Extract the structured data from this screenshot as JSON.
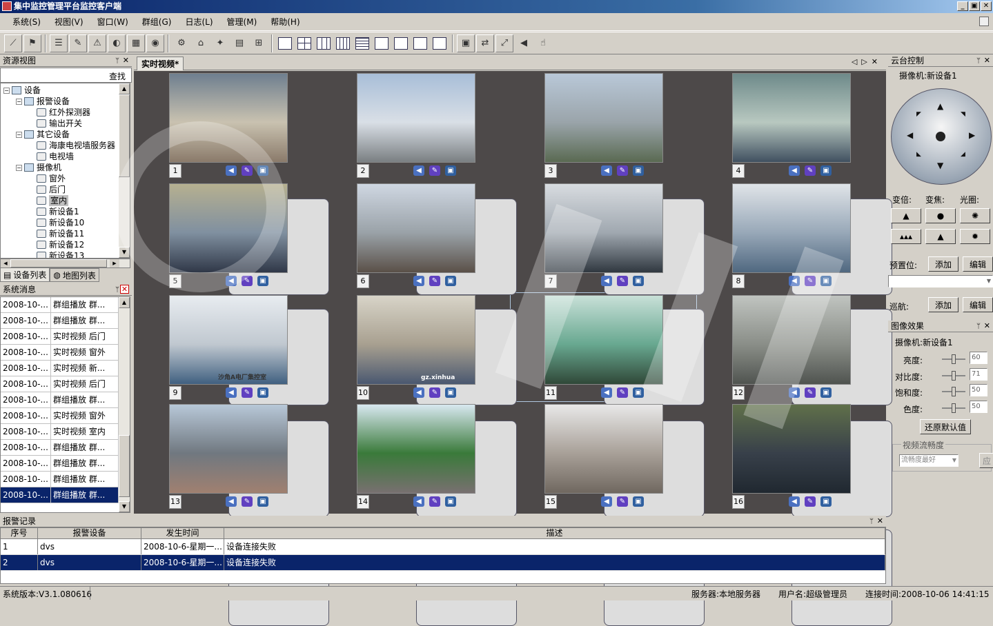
{
  "window": {
    "title": "集中监控管理平台监控客户端",
    "min": "_",
    "max": "▣",
    "close": "✕"
  },
  "menu": [
    "系统(S)",
    "视图(V)",
    "窗口(W)",
    "群组(G)",
    "日志(L)",
    "管理(M)",
    "帮助(H)"
  ],
  "resource": {
    "title": "资源视图",
    "search_label": "查找",
    "tree": [
      {
        "label": "设备",
        "level": 0,
        "exp": "−"
      },
      {
        "label": "报警设备",
        "level": 1,
        "exp": "−"
      },
      {
        "label": "红外探测器",
        "level": 2
      },
      {
        "label": "输出开关",
        "level": 2
      },
      {
        "label": "其它设备",
        "level": 1,
        "exp": "−"
      },
      {
        "label": "海康电视墙服务器",
        "level": 2
      },
      {
        "label": "电视墙",
        "level": 2
      },
      {
        "label": "摄像机",
        "level": 1,
        "exp": "−"
      },
      {
        "label": "窗外",
        "level": 2
      },
      {
        "label": "后门",
        "level": 2
      },
      {
        "label": "室内",
        "level": 2,
        "selected": true
      },
      {
        "label": "新设备1",
        "level": 2
      },
      {
        "label": "新设备10",
        "level": 2
      },
      {
        "label": "新设备11",
        "level": 2
      },
      {
        "label": "新设备12",
        "level": 2
      },
      {
        "label": "新设备13",
        "level": 2
      }
    ],
    "tabs": [
      "设备列表",
      "地图列表"
    ]
  },
  "messages": {
    "title": "系统消息",
    "rows": [
      [
        "2008-10-...",
        "群组播放  群..."
      ],
      [
        "2008-10-...",
        "群组播放  群..."
      ],
      [
        "2008-10-...",
        "实时视频  后门"
      ],
      [
        "2008-10-...",
        "实时视频  窗外"
      ],
      [
        "2008-10-...",
        "实时视频  新..."
      ],
      [
        "2008-10-...",
        "实时视频  后门"
      ],
      [
        "2008-10-...",
        "群组播放  群..."
      ],
      [
        "2008-10-...",
        "实时视频  窗外"
      ],
      [
        "2008-10-...",
        "实时视频  室内"
      ],
      [
        "2008-10-...",
        "群组播放  群..."
      ],
      [
        "2008-10-...",
        "群组播放  群..."
      ],
      [
        "2008-10-...",
        "群组播放  群..."
      ],
      [
        "2008-10-...",
        "群组播放  群..."
      ]
    ]
  },
  "video": {
    "tab": "实时视频*",
    "cells": [
      "1",
      "2",
      "3",
      "4",
      "5",
      "6",
      "7",
      "8",
      "9",
      "10",
      "11",
      "12",
      "13",
      "14",
      "15",
      "16"
    ],
    "captions": {
      "c9": "沙角A电厂集控室",
      "c10": "gz.xinhua"
    }
  },
  "ptz": {
    "title": "云台控制",
    "camera": "摄像机:新设备1",
    "zoom": "变倍:",
    "focus": "变焦:",
    "iris": "光圈:",
    "preset": "预置位:",
    "cruise": "巡航:",
    "add": "添加",
    "edit": "编辑"
  },
  "image": {
    "title": "图像效果",
    "camera": "摄像机:新设备1",
    "brightness": "亮度:",
    "brightness_v": "60",
    "contrast": "对比度:",
    "contrast_v": "71",
    "saturation": "饱和度:",
    "saturation_v": "50",
    "hue": "色度:",
    "hue_v": "50",
    "reset": "还原默认值",
    "smooth_group": "视频流畅度",
    "smooth_value": "流畅度最好",
    "apply": "应"
  },
  "alarms": {
    "title": "报警记录",
    "headers": [
      "序号",
      "报警设备",
      "发生时间",
      "描述"
    ],
    "rows": [
      [
        "1",
        "dvs",
        "2008-10-6-星期一...",
        "设备连接失败"
      ],
      [
        "2",
        "dvs",
        "2008-10-6-星期一...",
        "设备连接失败"
      ]
    ]
  },
  "status": {
    "version": "系统版本:V3.1.080616",
    "server": "服务器:本地服务器",
    "user": "用户名:超级管理员",
    "time": "连接时间:2008-10-06 14:41:15"
  },
  "colors": {
    "selection": "#0a246a",
    "video_bg": "#4d4949"
  }
}
